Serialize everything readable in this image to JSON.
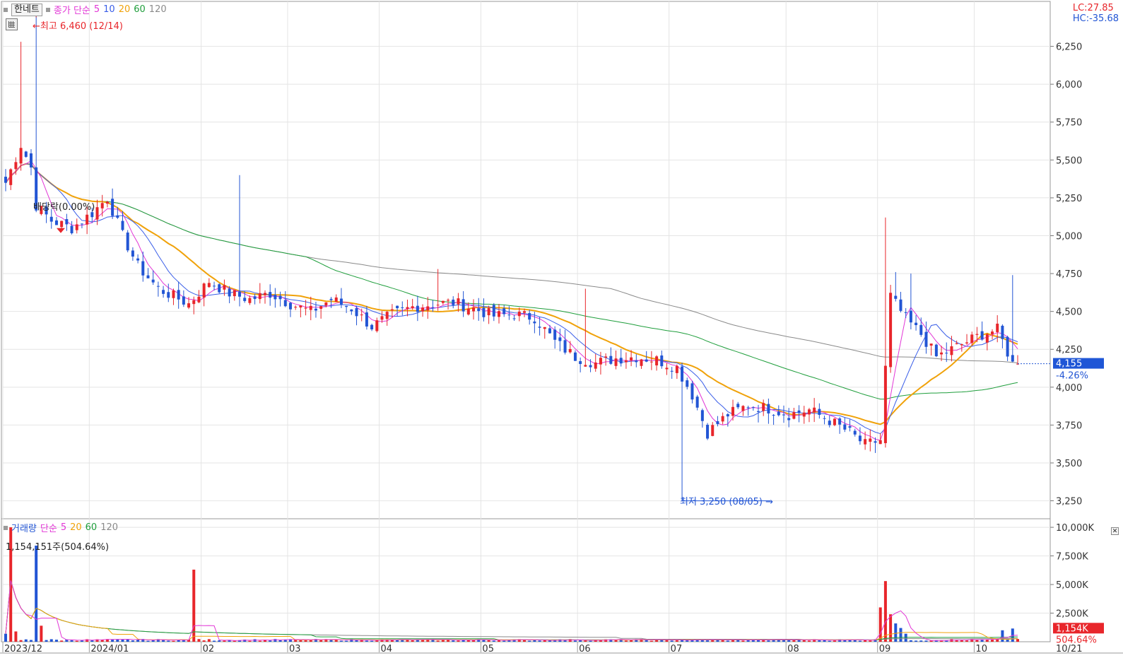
{
  "price_legend": {
    "stock_button": "한네트",
    "ma_label": "종가 단순",
    "periods": [
      "5",
      "10",
      "20",
      "60",
      "120"
    ]
  },
  "volume_legend": {
    "title": "거래량",
    "ma_label": "단순",
    "periods": [
      "5",
      "20",
      "60",
      "120"
    ]
  },
  "top_right": {
    "lc": "LC:27.85",
    "hc": "HC:-35.68"
  },
  "volume_info": "1,154,151주(504.64%)",
  "annotations": {
    "high": "최고 6,460 (12/14)",
    "low": "최저 3,250 (08/05)",
    "ex_div": "배당락(0.00%)"
  },
  "current": {
    "price": "4,155",
    "change": "-4.26%",
    "volume": "1,154K",
    "volume_pct": "504.64%"
  },
  "colors": {
    "up": "#e8262b",
    "down": "#2255d4",
    "ma5": "#e236d6",
    "ma10": "#3a5ee8",
    "ma20": "#f0a20a",
    "ma60": "#1f9e3c",
    "ma120": "#8a8a8a",
    "grid": "#e4e4e4",
    "axis_text": "#333333"
  },
  "chart_data": [
    {
      "type": "candlestick",
      "title": "한네트",
      "ylim": [
        3150,
        6500
      ],
      "y_ticks": [
        "6,250",
        "6,000",
        "5,750",
        "5,500",
        "5,250",
        "5,000",
        "4,750",
        "4,500",
        "4,250",
        "4,000",
        "3,750",
        "3,500",
        "3,250"
      ],
      "y_tick_values": [
        6250,
        6000,
        5750,
        5500,
        5250,
        5000,
        4750,
        4500,
        4250,
        4000,
        3750,
        3500,
        3250
      ],
      "x_labels": [
        "2023/12",
        "2024/01",
        "02",
        "03",
        "04",
        "05",
        "06",
        "07",
        "08",
        "09",
        "10",
        "10/21"
      ],
      "period_start": "2023/12",
      "period_end": "10/21",
      "high": {
        "value": 6460,
        "date": "12/14"
      },
      "low": {
        "value": 3250,
        "date": "08/05"
      },
      "last_close": 4155,
      "last_change_pct": -4.26,
      "ma_periods": [
        5,
        10,
        20,
        60,
        120
      ],
      "price_path_anchors": [
        [
          0,
          5350
        ],
        [
          3,
          5600
        ],
        [
          5,
          5450
        ],
        [
          6,
          5200
        ],
        [
          9,
          5100
        ],
        [
          13,
          5050
        ],
        [
          17,
          5150
        ],
        [
          20,
          5250
        ],
        [
          23,
          5000
        ],
        [
          26,
          4800
        ],
        [
          30,
          4650
        ],
        [
          36,
          4550
        ],
        [
          40,
          4700
        ],
        [
          44,
          4620
        ],
        [
          48,
          4580
        ],
        [
          52,
          4620
        ],
        [
          56,
          4550
        ],
        [
          60,
          4500
        ],
        [
          64,
          4580
        ],
        [
          68,
          4520
        ],
        [
          72,
          4400
        ],
        [
          76,
          4480
        ],
        [
          80,
          4530
        ],
        [
          84,
          4550
        ],
        [
          88,
          4560
        ],
        [
          92,
          4520
        ],
        [
          96,
          4470
        ],
        [
          100,
          4480
        ],
        [
          104,
          4460
        ],
        [
          108,
          4300
        ],
        [
          112,
          4200
        ],
        [
          116,
          4160
        ],
        [
          120,
          4190
        ],
        [
          124,
          4200
        ],
        [
          128,
          4180
        ],
        [
          132,
          4130
        ],
        [
          135,
          3950
        ],
        [
          138,
          3700
        ],
        [
          142,
          3820
        ],
        [
          146,
          3880
        ],
        [
          150,
          3860
        ],
        [
          154,
          3820
        ],
        [
          158,
          3850
        ],
        [
          162,
          3780
        ],
        [
          166,
          3700
        ],
        [
          169,
          3620
        ],
        [
          172,
          3650
        ],
        [
          174,
          4600
        ],
        [
          177,
          4450
        ],
        [
          180,
          4350
        ],
        [
          183,
          4200
        ],
        [
          186,
          4250
        ],
        [
          189,
          4300
        ],
        [
          192,
          4350
        ],
        [
          195,
          4380
        ],
        [
          198,
          4155
        ]
      ]
    },
    {
      "type": "bar",
      "title": "거래량",
      "ylim": [
        0,
        10500000
      ],
      "y_ticks": [
        "10,000K",
        "7,500K",
        "5,000K",
        "2,500K"
      ],
      "y_tick_values": [
        10000000,
        7500000,
        5000000,
        2500000
      ],
      "last_volume": 1154151,
      "last_volume_pct": 504.64,
      "spikes": [
        {
          "date": "2023/12",
          "value": 10000000
        },
        {
          "date": "2023/12",
          "value": 8400000
        },
        {
          "date": "02",
          "value": 6300000
        },
        {
          "date": "09",
          "value": 5300000
        },
        {
          "date": "09",
          "value": 3000000
        }
      ]
    }
  ]
}
